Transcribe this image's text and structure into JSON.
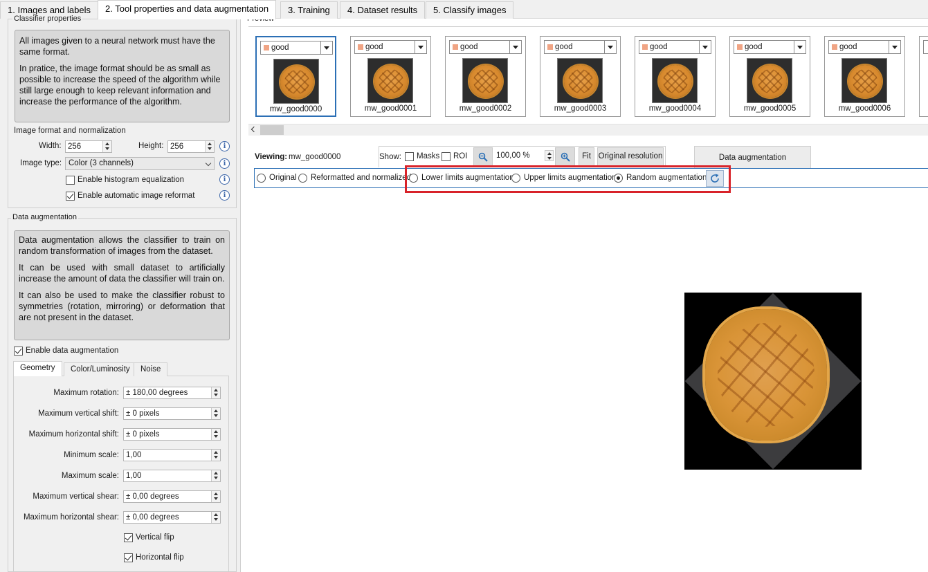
{
  "tabs": [
    {
      "label": "1. Images and labels"
    },
    {
      "label": "2. Tool properties and data augmentation"
    },
    {
      "label": "3. Training"
    },
    {
      "label": "4. Dataset results"
    },
    {
      "label": "5. Classify images"
    }
  ],
  "classifier": {
    "group_title": "Classifier properties",
    "info_p1": "All images given to a neural network must have the same format.",
    "info_p2": "In pratice, the image format should be as small as possible to increase the speed of the algorithm while still large enough to keep relevant information and increase the performance of the algorithm.",
    "format_title": "Image format and normalization",
    "width_label": "Width:",
    "width_value": "256",
    "height_label": "Height:",
    "height_value": "256",
    "type_label": "Image type:",
    "type_value": "Color (3 channels)",
    "hist_label": "Enable histogram equalization",
    "hist_checked": false,
    "reformat_label": "Enable automatic image reformat",
    "reformat_checked": true
  },
  "augmentation": {
    "group_title": "Data augmentation",
    "info_p1": "Data augmentation allows the classifier to train on random transformation of images from the dataset.",
    "info_p2": "It can be used with small dataset to artificially increase the amount of data the classifier will train on.",
    "info_p3": "It can also be used to make the classifier robust to symmetries (rotation, mirroring) or deformation that are not present in the dataset.",
    "enable_label": "Enable data augmentation",
    "enable_checked": true,
    "subtabs": [
      "Geometry",
      "Color/Luminosity",
      "Noise"
    ],
    "fields": [
      {
        "label": "Maximum rotation:",
        "value": "± 180,00 degrees"
      },
      {
        "label": "Maximum vertical shift:",
        "value": "± 0 pixels"
      },
      {
        "label": "Maximum horizontal shift:",
        "value": "± 0 pixels"
      },
      {
        "label": "Minimum scale:",
        "value": "1,00"
      },
      {
        "label": "Maximum scale:",
        "value": "1,00"
      },
      {
        "label": "Maximum vertical shear:",
        "value": "± 0,00 degrees"
      },
      {
        "label": "Maximum horizontal shear:",
        "value": "± 0,00 degrees"
      }
    ],
    "vflip_label": "Vertical flip",
    "vflip_checked": true,
    "hflip_label": "Horizontal flip",
    "hflip_checked": true
  },
  "preview": {
    "title": "Preview",
    "label_color": "#f0a484",
    "thumbs": [
      {
        "label": "good",
        "name": "mw_good0000"
      },
      {
        "label": "good",
        "name": "mw_good0001"
      },
      {
        "label": "good",
        "name": "mw_good0002"
      },
      {
        "label": "good",
        "name": "mw_good0003"
      },
      {
        "label": "good",
        "name": "mw_good0004"
      },
      {
        "label": "good",
        "name": "mw_good0005"
      },
      {
        "label": "good",
        "name": "mw_good0006"
      }
    ]
  },
  "viewer": {
    "viewing_label": "Viewing:",
    "viewing_value": "mw_good0000",
    "show_label": "Show:",
    "masks_label": "Masks",
    "roi_label": "ROI",
    "zoom_value": "100,00 %",
    "fit_label": "Fit",
    "orig_res_label": "Original resolution",
    "aug_vis_label": "Data augmentation visualizations",
    "modes": [
      {
        "label": "Original",
        "selected": false
      },
      {
        "label": "Reformatted and normalized",
        "selected": false
      },
      {
        "label": "Lower limits augmentation",
        "selected": false
      },
      {
        "label": "Upper limits augmentation",
        "selected": false
      },
      {
        "label": "Random augmentation",
        "selected": true
      }
    ],
    "highlight_color": "#d8232a"
  }
}
